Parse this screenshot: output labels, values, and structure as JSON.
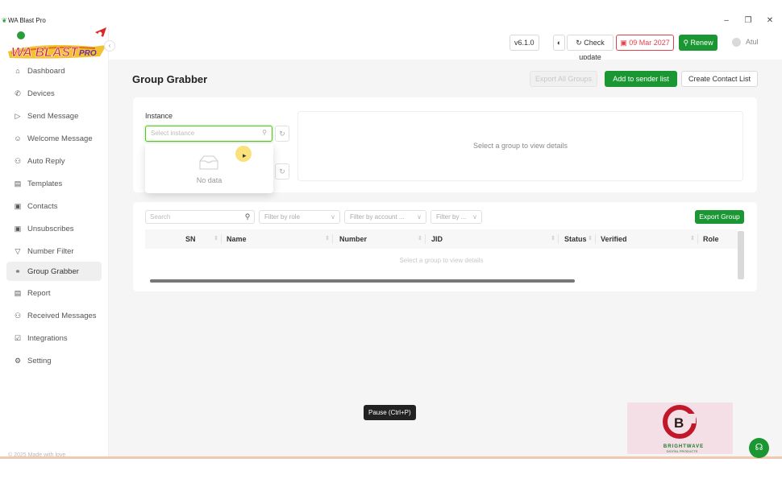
{
  "window": {
    "title": "WA Blast Pro",
    "controls": [
      "–",
      "❐",
      "✕"
    ]
  },
  "logo": {
    "text": "WA BLAST PRO"
  },
  "sidebar": {
    "items": [
      {
        "label": "Dashboard",
        "icon": "home-icon"
      },
      {
        "label": "Devices",
        "icon": "whatsapp-icon"
      },
      {
        "label": "Send Message",
        "icon": "send-icon"
      },
      {
        "label": "Welcome Message",
        "icon": "smile-icon"
      },
      {
        "label": "Auto Reply",
        "icon": "robot-icon"
      },
      {
        "label": "Templates",
        "icon": "file-icon"
      },
      {
        "label": "Contacts",
        "icon": "contacts-icon"
      },
      {
        "label": "Unsubscribes",
        "icon": "contacts-icon"
      },
      {
        "label": "Number Filter",
        "icon": "filter-icon"
      },
      {
        "label": "Group Grabber",
        "icon": "group-icon",
        "active": true
      },
      {
        "label": "Report",
        "icon": "report-icon"
      },
      {
        "label": "Received Messages",
        "icon": "message-icon"
      },
      {
        "label": "Integrations",
        "icon": "integration-icon"
      },
      {
        "label": "Setting",
        "icon": "gear-icon"
      }
    ],
    "copyright": "© 2025 Made with love"
  },
  "topbar": {
    "version": "v6.1.0",
    "theme_icon": "theme-toggle-icon",
    "check_update": "Check update",
    "expiry_date": "09 Mar 2027",
    "renew": "Renew",
    "user": "Atul"
  },
  "page": {
    "title": "Group Grabber",
    "export_all_groups": "Export All Groups",
    "add_to_sender_list": "Add to sender list",
    "create_contact_list": "Create Contact List"
  },
  "instance": {
    "label": "Instance",
    "placeholder": "Select instance",
    "dropdown_empty": "No data"
  },
  "details": {
    "empty_message": "Select a group to view details"
  },
  "table": {
    "search_placeholder": "Search",
    "filters": [
      "Filter by role",
      "Filter by account ...",
      "Filter by ..."
    ],
    "export_group": "Export Group",
    "columns": [
      "SN",
      "Name",
      "Number",
      "JID",
      "Status",
      "Verified",
      "Role"
    ],
    "empty_message": "Select a group to view details"
  },
  "overlay": {
    "tooltip": "Pause (Ctrl+P)",
    "brand_name": "BRIGHTWAVE",
    "brand_sub": "DIGITAL PRODUCTS"
  },
  "colors": {
    "primary": "#1a9632",
    "danger": "#e2404a",
    "muted_bg": "#f5f5f5"
  }
}
